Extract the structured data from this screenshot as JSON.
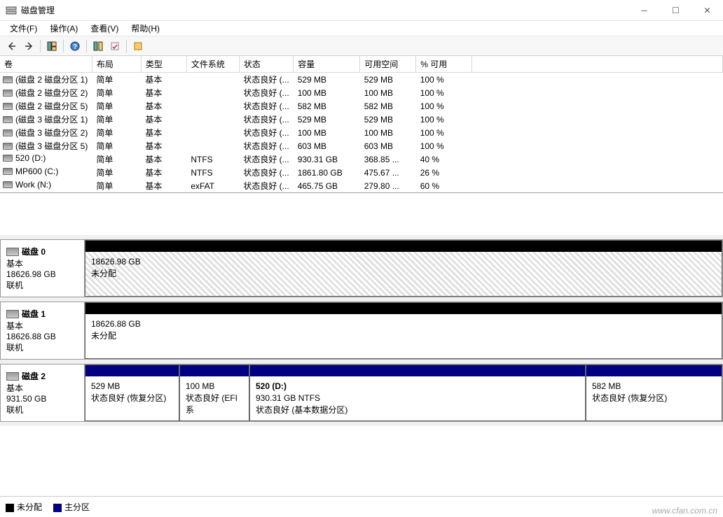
{
  "window": {
    "title": "磁盘管理"
  },
  "menu": {
    "file": "文件(F)",
    "action": "操作(A)",
    "view": "查看(V)",
    "help": "帮助(H)"
  },
  "columns": {
    "volume": "卷",
    "layout": "布局",
    "type": "类型",
    "fs": "文件系统",
    "status": "状态",
    "capacity": "容量",
    "free": "可用空间",
    "pctfree": "% 可用"
  },
  "volumes": [
    {
      "name": "(磁盘 2 磁盘分区 1)",
      "layout": "简单",
      "type": "基本",
      "fs": "",
      "status": "状态良好 (...",
      "capacity": "529 MB",
      "free": "529 MB",
      "pctfree": "100 %"
    },
    {
      "name": "(磁盘 2 磁盘分区 2)",
      "layout": "简单",
      "type": "基本",
      "fs": "",
      "status": "状态良好 (...",
      "capacity": "100 MB",
      "free": "100 MB",
      "pctfree": "100 %"
    },
    {
      "name": "(磁盘 2 磁盘分区 5)",
      "layout": "简单",
      "type": "基本",
      "fs": "",
      "status": "状态良好 (...",
      "capacity": "582 MB",
      "free": "582 MB",
      "pctfree": "100 %"
    },
    {
      "name": "(磁盘 3 磁盘分区 1)",
      "layout": "简单",
      "type": "基本",
      "fs": "",
      "status": "状态良好 (...",
      "capacity": "529 MB",
      "free": "529 MB",
      "pctfree": "100 %"
    },
    {
      "name": "(磁盘 3 磁盘分区 2)",
      "layout": "简单",
      "type": "基本",
      "fs": "",
      "status": "状态良好 (...",
      "capacity": "100 MB",
      "free": "100 MB",
      "pctfree": "100 %"
    },
    {
      "name": "(磁盘 3 磁盘分区 5)",
      "layout": "简单",
      "type": "基本",
      "fs": "",
      "status": "状态良好 (...",
      "capacity": "603 MB",
      "free": "603 MB",
      "pctfree": "100 %"
    },
    {
      "name": "520 (D:)",
      "layout": "简单",
      "type": "基本",
      "fs": "NTFS",
      "status": "状态良好 (...",
      "capacity": "930.31 GB",
      "free": "368.85 ...",
      "pctfree": "40 %"
    },
    {
      "name": "MP600 (C:)",
      "layout": "简单",
      "type": "基本",
      "fs": "NTFS",
      "status": "状态良好 (...",
      "capacity": "1861.80 GB",
      "free": "475.67 ...",
      "pctfree": "26 %"
    },
    {
      "name": "Work (N:)",
      "layout": "简单",
      "type": "基本",
      "fs": "exFAT",
      "status": "状态良好 (...",
      "capacity": "465.75 GB",
      "free": "279.80 ...",
      "pctfree": "60 %"
    }
  ],
  "disks": [
    {
      "name": "磁盘 0",
      "type": "基本",
      "size": "18626.98 GB",
      "status": "联机",
      "parts": [
        {
          "title": "",
          "size": "18626.98 GB",
          "status": "未分配",
          "cls": "unalloc"
        }
      ]
    },
    {
      "name": "磁盘 1",
      "type": "基本",
      "size": "18626.88 GB",
      "status": "联机",
      "parts": [
        {
          "title": "",
          "size": "18626.88 GB",
          "status": "未分配",
          "cls": "unalloc-plain"
        }
      ]
    },
    {
      "name": "磁盘 2",
      "type": "基本",
      "size": "931.50 GB",
      "status": "联机",
      "parts": [
        {
          "title": "",
          "size": "529 MB",
          "status": "状态良好 (恢复分区)",
          "cls": "primary p1"
        },
        {
          "title": "",
          "size": "100 MB",
          "status": "状态良好 (EFI 系",
          "cls": "primary p2"
        },
        {
          "title": "520  (D:)",
          "size": "930.31 GB NTFS",
          "status": "状态良好 (基本数据分区)",
          "cls": "primary p3"
        },
        {
          "title": "",
          "size": "582 MB",
          "status": "状态良好 (恢复分区)",
          "cls": "primary p4"
        }
      ]
    }
  ],
  "legend": {
    "unalloc": "未分配",
    "primary": "主分区"
  },
  "watermark": "www.cfan.com.cn"
}
